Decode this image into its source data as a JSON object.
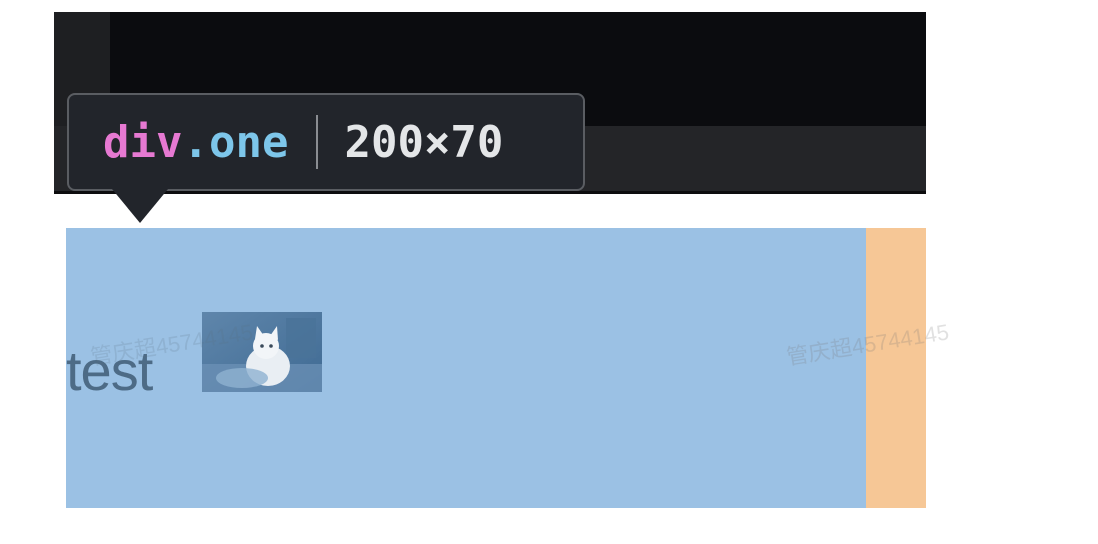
{
  "inspector": {
    "tag": "div",
    "dot": ".",
    "class_name": "one",
    "dimensions": "200×70"
  },
  "element": {
    "text": "test",
    "image_name": "cat-image"
  },
  "watermark": {
    "text_1": "管庆超45744145",
    "text_2": "管庆超45744145"
  },
  "colors": {
    "content_highlight": "#9bc1e4",
    "margin_highlight": "#f6c796",
    "tooltip_bg": "#22252b",
    "tag_color": "#e679d2",
    "class_color": "#7dc6ea"
  }
}
